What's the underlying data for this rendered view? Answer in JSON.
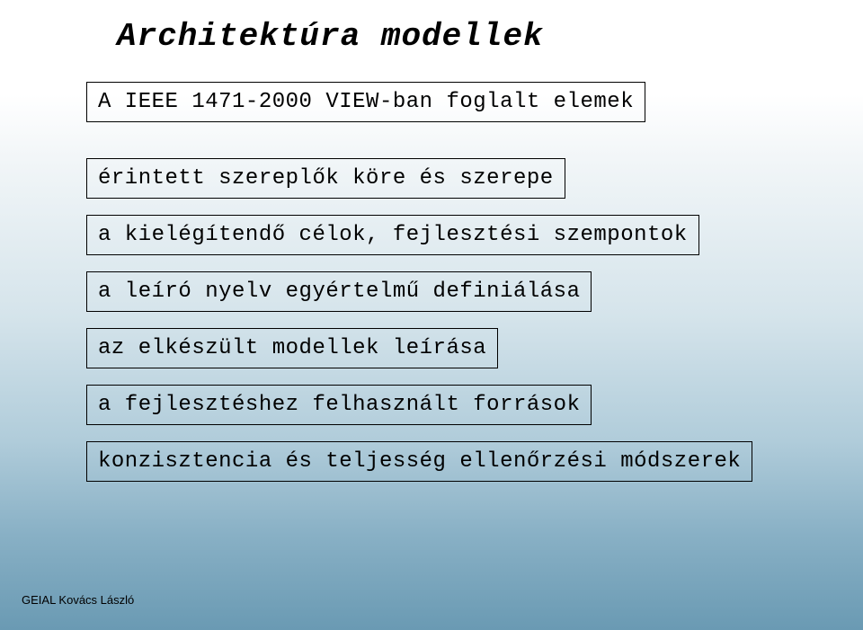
{
  "title": "Architektúra modellek",
  "subtitle": "A IEEE 1471-2000 VIEW-ban foglalt elemek",
  "items": [
    "érintett szereplők köre és szerepe",
    "a kielégítendő célok, fejlesztési szempontok",
    "a leíró nyelv egyértelmű definiálása",
    "az elkészült modellek leírása",
    "a fejlesztéshez felhasznált források",
    "konzisztencia és teljesség ellenőrzési módszerek"
  ],
  "footer": "GEIAL Kovács László"
}
